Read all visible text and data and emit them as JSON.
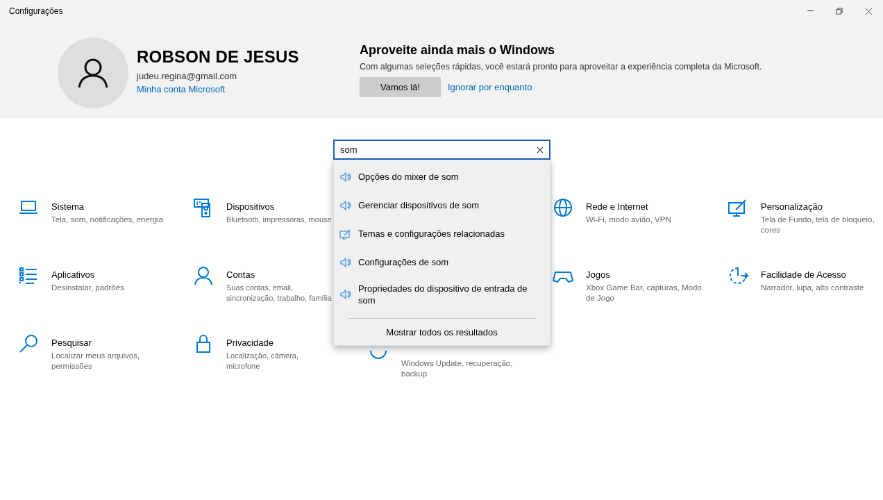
{
  "window": {
    "title": "Configurações"
  },
  "account": {
    "name": "ROBSON DE JESUS",
    "email": "judeu.regina@gmail.com",
    "link": "Minha conta Microsoft"
  },
  "promo": {
    "title": "Aproveite ainda mais o Windows",
    "text": "Com algumas seleções rápidas, você estará pronto para aproveitar a experiência completa da Microsoft.",
    "button": "Vamos lá!",
    "link": "Ignorar por enquanto"
  },
  "search": {
    "value": "som",
    "results": [
      {
        "kind": "sound",
        "label": "Opções do mixer de som"
      },
      {
        "kind": "sound",
        "label": "Gerenciar dispositivos de som"
      },
      {
        "kind": "theme",
        "label": "Temas e configurações relacionadas"
      },
      {
        "kind": "sound",
        "label": "Configurações de som"
      },
      {
        "kind": "sound",
        "label": "Propriedades do dispositivo de entrada de som"
      }
    ],
    "show_all": "Mostrar todos os resultados"
  },
  "categories": [
    {
      "left": [
        {
          "kind": "laptop",
          "title": "Sistema",
          "description": "Tela, som, notificações, energia"
        },
        {
          "kind": "devices",
          "title": "Dispositivos",
          "description": "Bluetooth, impressoras, mouse"
        }
      ],
      "right": [
        {
          "kind": "globe",
          "title": "Rede e Internet",
          "description": "Wi-Fi, modo avião, VPN"
        },
        {
          "kind": "paint",
          "title": "Personalização",
          "description": "Tela de Fundo, tela de bloqueio, cores"
        }
      ]
    },
    {
      "left": [
        {
          "kind": "apps",
          "title": "Aplicativos",
          "description": "Desinstalar, padrões"
        },
        {
          "kind": "person",
          "title": "Contas",
          "description": "Suas contas, email, sincronização, trabalho, família"
        }
      ],
      "right": [
        {
          "kind": "gamepad",
          "title": "Jogos",
          "description": "Xbox Game Bar, capturas, Modo de Jogo"
        },
        {
          "kind": "access",
          "title": "Facilidade de Acesso",
          "description": "Narrador, lupa, alto contraste"
        }
      ]
    },
    {
      "left": [
        {
          "kind": "search",
          "title": "Pesquisar",
          "description": "Localizar meus arquivos, permissões"
        },
        {
          "kind": "lock",
          "title": "Privacidade",
          "description": "Localização, câmera, microfone"
        }
      ],
      "middle": {
        "kind": "update",
        "description": "Windows Update, recuperação, backup"
      }
    }
  ]
}
